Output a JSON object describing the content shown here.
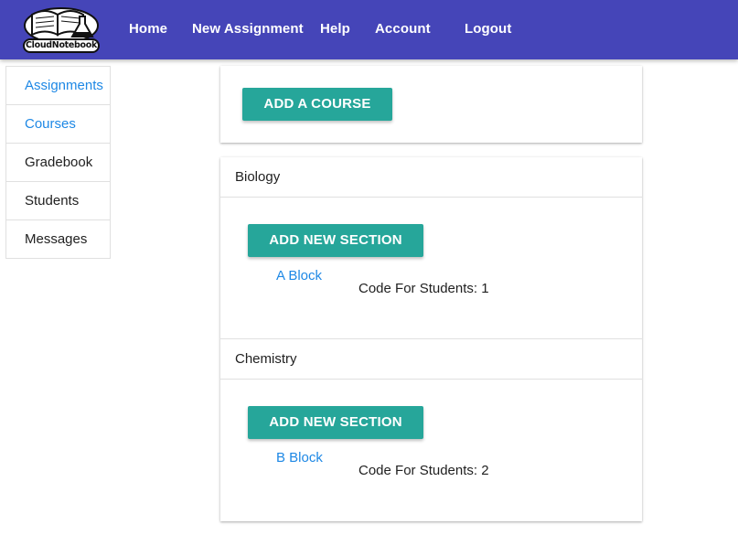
{
  "app": {
    "logo_text": "CloudNotebook"
  },
  "nav": {
    "links": [
      {
        "label": "Home"
      },
      {
        "label": "New Assignment"
      },
      {
        "label": "Help"
      },
      {
        "label": "Account"
      },
      {
        "label": "Logout"
      }
    ]
  },
  "sidebar": {
    "items": [
      {
        "label": "Assignments",
        "active": true
      },
      {
        "label": "Courses",
        "active": true
      },
      {
        "label": "Gradebook",
        "active": false
      },
      {
        "label": "Students",
        "active": false
      },
      {
        "label": "Messages",
        "active": false
      }
    ]
  },
  "main": {
    "add_course_label": "ADD A COURSE",
    "courses": [
      {
        "name": "Biology",
        "add_section_label": "ADD NEW SECTION",
        "sections": [
          {
            "name": "A Block",
            "code_text": "Code For Students: 1"
          }
        ]
      },
      {
        "name": "Chemistry",
        "add_section_label": "ADD NEW SECTION",
        "sections": [
          {
            "name": "B Block",
            "code_text": "Code For Students: 2"
          }
        ]
      }
    ]
  },
  "colors": {
    "navbar": "#4545b8",
    "button": "#26a69a",
    "link": "#1e88e5"
  }
}
